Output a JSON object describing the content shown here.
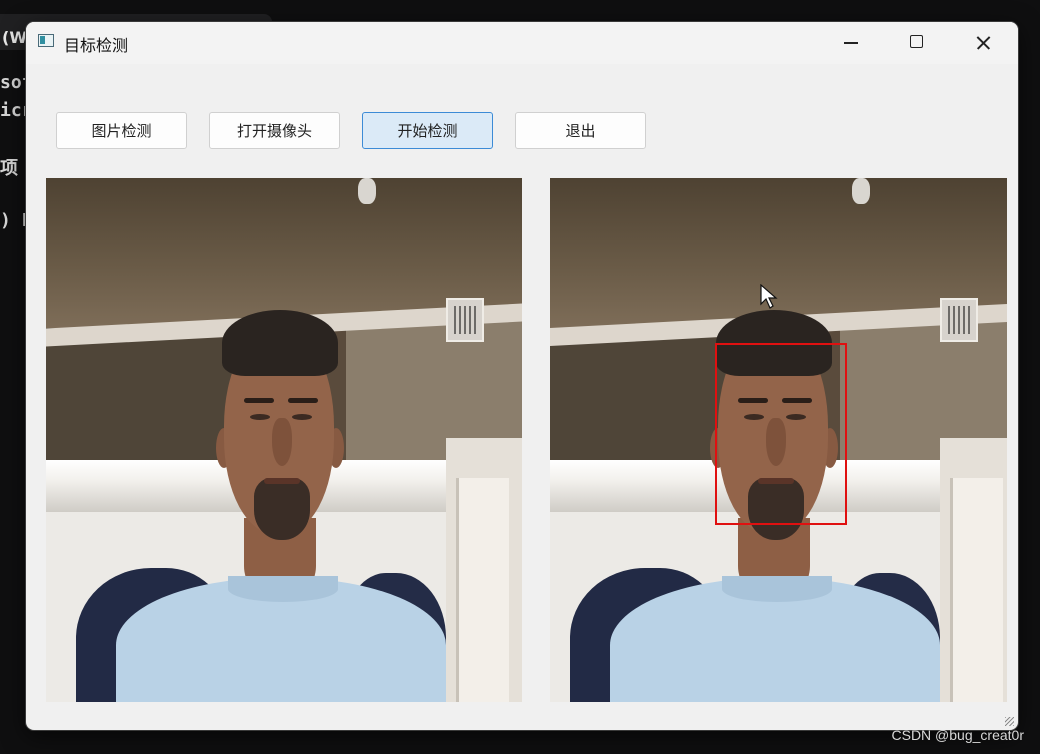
{
  "background_terminal": {
    "tab_fragment": "(Wi",
    "lines": [
      "sof",
      "icr",
      "项",
      ") F"
    ]
  },
  "window": {
    "title": "目标检测",
    "controls": {
      "minimize": "minimize-icon",
      "maximize": "maximize-icon",
      "close": "close-icon"
    }
  },
  "toolbar": {
    "image_detect_label": "图片检测",
    "open_camera_label": "打开摄像头",
    "start_detect_label": "开始检测",
    "exit_label": "退出",
    "active_button": "开始检测"
  },
  "panels": {
    "left": {
      "content": "camera-frame"
    },
    "right": {
      "content": "detection-frame",
      "detection_box_color": "#e01010"
    }
  },
  "colors": {
    "accent": "#3c8bd6",
    "active_button_bg": "#dbeaf7",
    "box": "#e01010"
  },
  "watermark": "CSDN @bug_creat0r"
}
